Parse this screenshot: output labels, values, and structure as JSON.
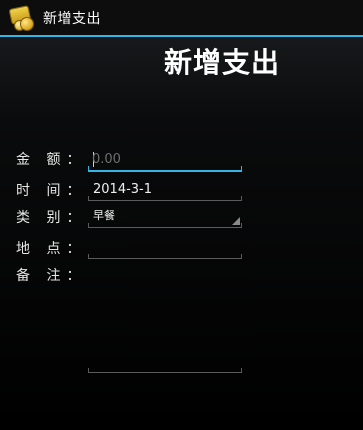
{
  "app": {
    "title": "新增支出"
  },
  "page": {
    "heading": "新增支出"
  },
  "form": {
    "amount": {
      "label": "金 额：",
      "value": "",
      "placeholder": "0.00"
    },
    "time": {
      "label": "时 间：",
      "value": "2014-3-1"
    },
    "category": {
      "label": "类 别：",
      "selected": "早餐"
    },
    "location": {
      "label": "地 点：",
      "value": ""
    },
    "notes": {
      "label": "备 注：",
      "value": ""
    }
  },
  "colors": {
    "accent": "#33b5e5",
    "underline": "#5b5b5b"
  }
}
